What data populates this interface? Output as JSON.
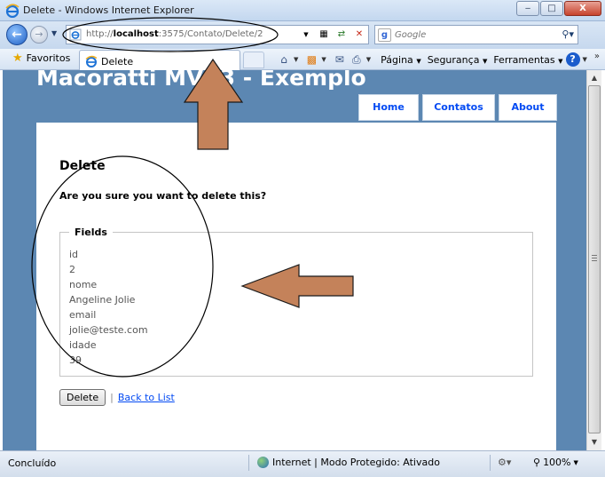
{
  "window": {
    "title": "Delete - Windows Internet Explorer",
    "minimize_label": "‒",
    "maximize_label": "□",
    "close_label": "X"
  },
  "address_bar": {
    "url_prefix": "http://",
    "url_host": "localhost",
    "url_path": ":3575/Contato/Delete/2"
  },
  "search": {
    "placeholder": "Google"
  },
  "toolbar": {
    "favorites_label": "Favoritos",
    "tab_label": "Delete",
    "page_menu": "Página",
    "security_menu": "Segurança",
    "tools_menu": "Ferramentas"
  },
  "site": {
    "title": "Macoratti MVC3 - Exemplo",
    "menu": [
      {
        "label": "Home"
      },
      {
        "label": "Contatos"
      },
      {
        "label": "About"
      }
    ]
  },
  "page": {
    "heading": "Delete",
    "confirm_text": "Are you sure you want to delete this?",
    "fieldset_legend": "Fields",
    "fields": [
      {
        "label": "id",
        "value": "2"
      },
      {
        "label": "nome",
        "value": "Angeline Jolie"
      },
      {
        "label": "email",
        "value": "jolie@teste.com"
      },
      {
        "label": "idade",
        "value": "39"
      }
    ],
    "delete_button": "Delete",
    "separator": "|",
    "back_link": "Back to List"
  },
  "statusbar": {
    "status": "Concluído",
    "zone": "Internet | Modo Protegido: Ativado",
    "zoom": "100%"
  },
  "colors": {
    "page_background": "#5c87b2",
    "link": "#034af3",
    "annotation_arrow": "#c4825a"
  }
}
